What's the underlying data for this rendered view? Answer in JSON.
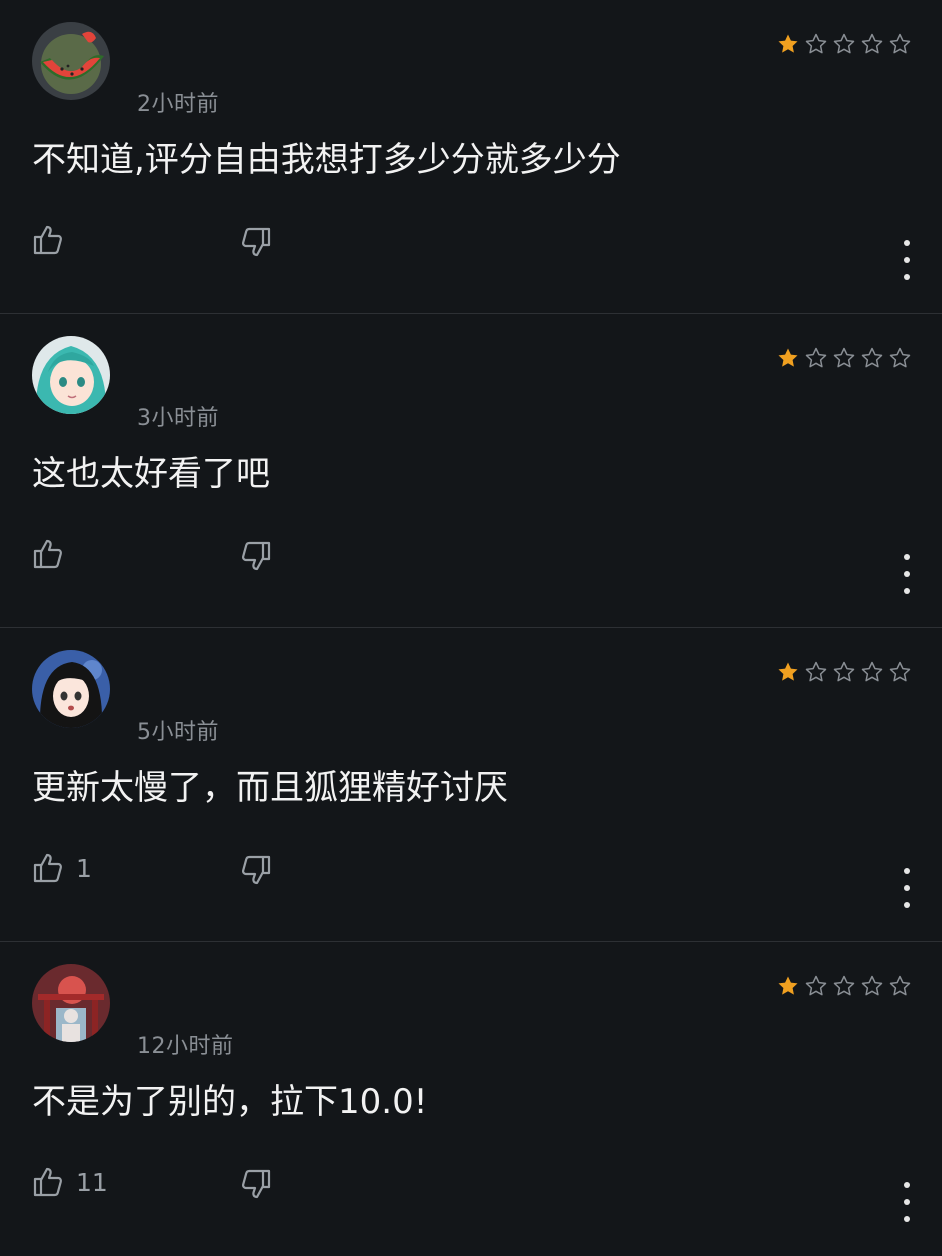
{
  "colors": {
    "background": "#131619",
    "divider": "#2d3034",
    "star_filled": "#f0a020",
    "star_empty": "#8a8f95",
    "muted_text": "#8a8f95"
  },
  "icons": {
    "like": "thumbs-up-icon",
    "dislike": "thumbs-down-icon",
    "more": "more-vertical-icon",
    "star": "star-icon"
  },
  "reviews": [
    {
      "time": "2小时前",
      "rating": 1,
      "max_rating": 5,
      "text": "不知道,评分自由我想打多少分就多少分",
      "likes": ""
    },
    {
      "time": "3小时前",
      "rating": 1,
      "max_rating": 5,
      "text": "这也太好看了吧",
      "likes": ""
    },
    {
      "time": "5小时前",
      "rating": 1,
      "max_rating": 5,
      "text": "更新太慢了，而且狐狸精好讨厌",
      "likes": "1"
    },
    {
      "time": "12小时前",
      "rating": 1,
      "max_rating": 5,
      "text": "不是为了别的，拉下10.0!",
      "likes": "11"
    }
  ]
}
